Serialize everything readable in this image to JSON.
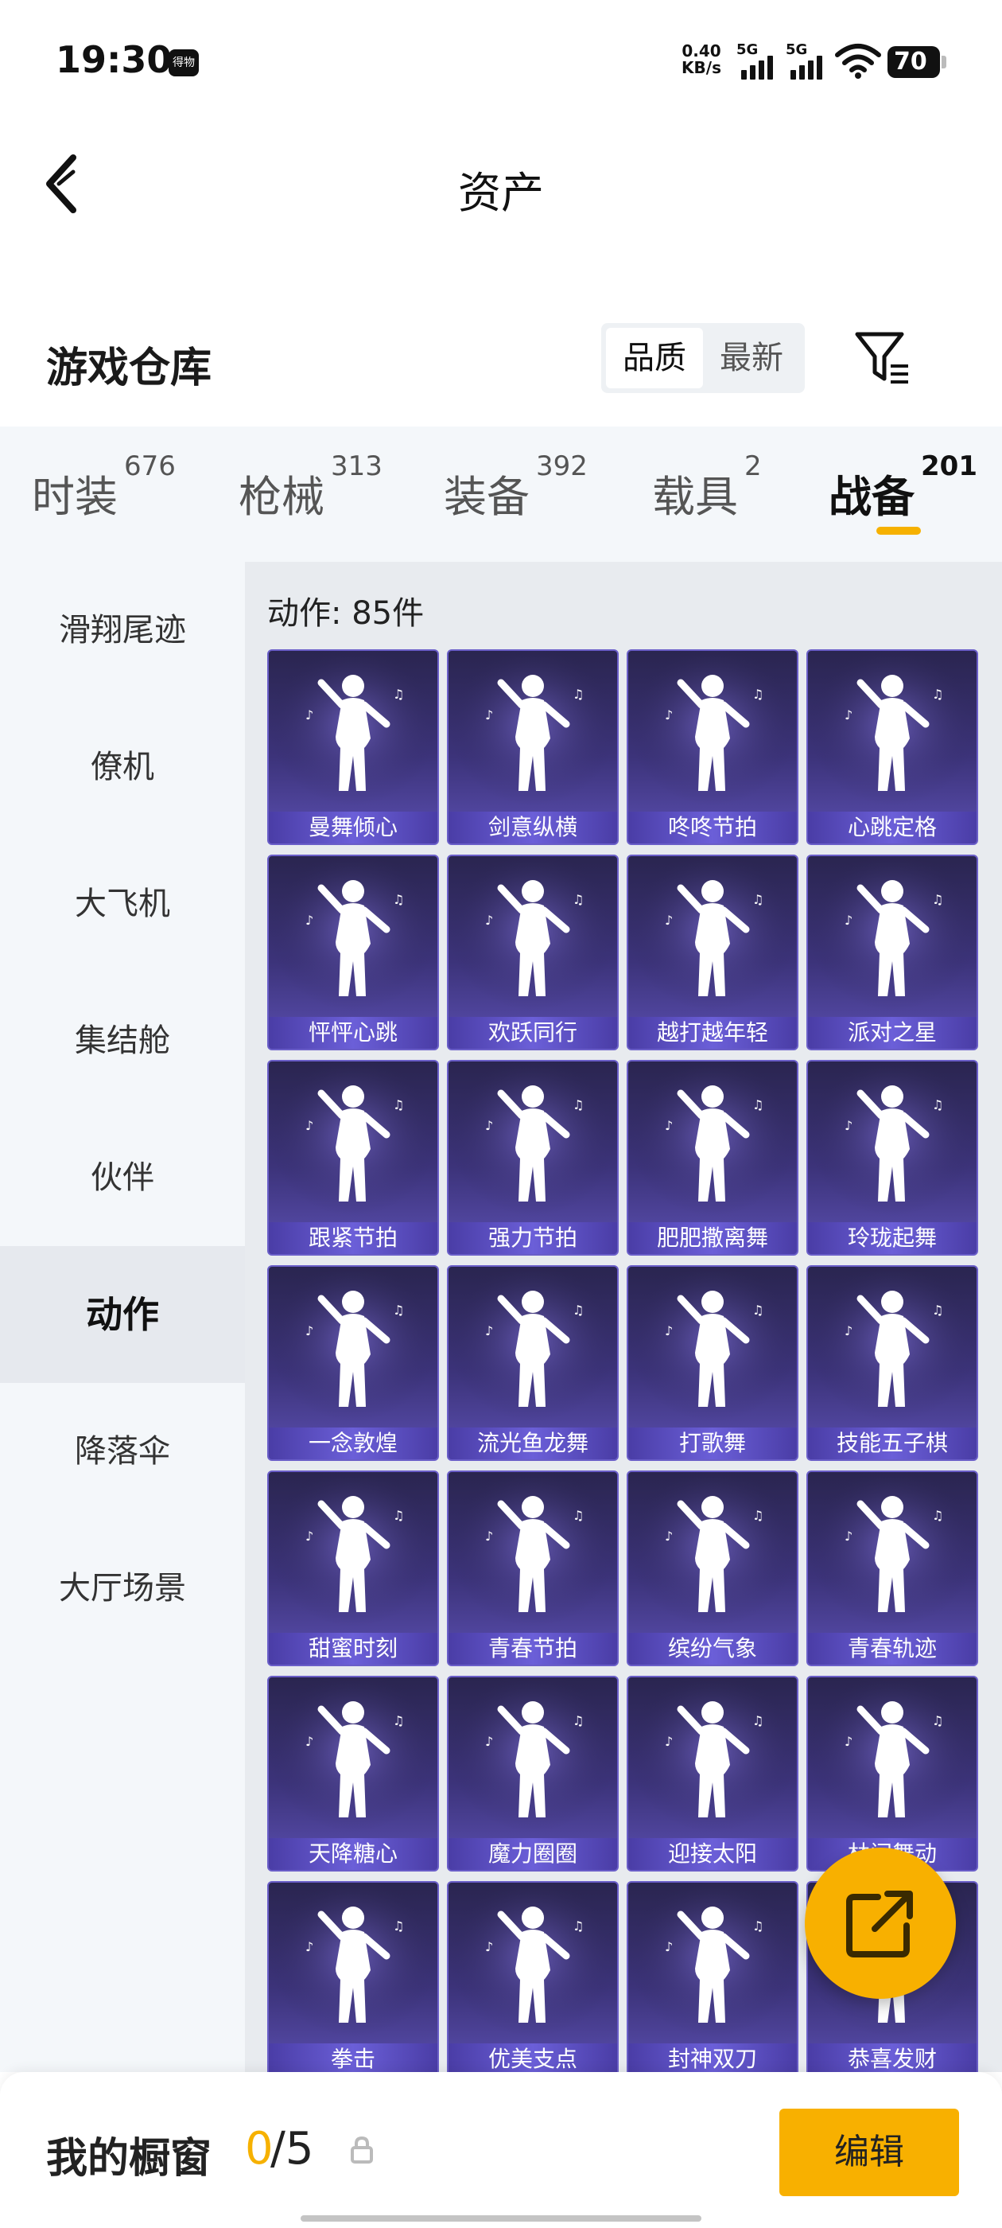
{
  "status_bar": {
    "time": "19:30",
    "app_badge": "得物",
    "speed_value": "0.40",
    "speed_unit": "KB/s",
    "net1": "5G",
    "net2": "5G",
    "battery": "70"
  },
  "header": {
    "title": "资产"
  },
  "section": {
    "title": "游戏仓库",
    "sort_options": [
      "品质",
      "最新"
    ],
    "active_sort": "品质"
  },
  "categories": [
    {
      "label": "时装",
      "count": "676"
    },
    {
      "label": "枪械",
      "count": "313"
    },
    {
      "label": "装备",
      "count": "392"
    },
    {
      "label": "载具",
      "count": "2"
    },
    {
      "label": "战备",
      "count": "201"
    }
  ],
  "active_category": "战备",
  "sidebar": {
    "items": [
      "滑翔尾迹",
      "僚机",
      "大飞机",
      "集结舱",
      "伙伴",
      "动作",
      "降落伞",
      "大厅场景"
    ],
    "active": "动作"
  },
  "content": {
    "count_label": "动作: 85件",
    "items": [
      "曼舞倾心",
      "剑意纵横",
      "咚咚节拍",
      "心跳定格",
      "怦怦心跳",
      "欢跃同行",
      "越打越年轻",
      "派对之星",
      "跟紧节拍",
      "强力节拍",
      "肥肥撒离舞",
      "玲珑起舞",
      "一念敦煌",
      "流光鱼龙舞",
      "打歌舞",
      "技能五子棋",
      "甜蜜时刻",
      "青春节拍",
      "缤纷气象",
      "青春轨迹",
      "天降糖心",
      "魔力圈圈",
      "迎接太阳",
      "林间舞动",
      "拳击",
      "优美支点",
      "封神双刀",
      "恭喜发财"
    ]
  },
  "bottom_bar": {
    "label": "我的橱窗",
    "current": "0",
    "total": "/5",
    "edit_label": "编辑"
  },
  "colors": {
    "accent": "#f8b000",
    "card_top": "#2a2550",
    "card_bottom": "#5b4fb1",
    "panel_bg": "#f4f7fa"
  },
  "icons": {
    "back": "chevron-left-icon",
    "filter": "filter-icon",
    "fab": "share-external-icon",
    "lock": "lock-icon"
  }
}
